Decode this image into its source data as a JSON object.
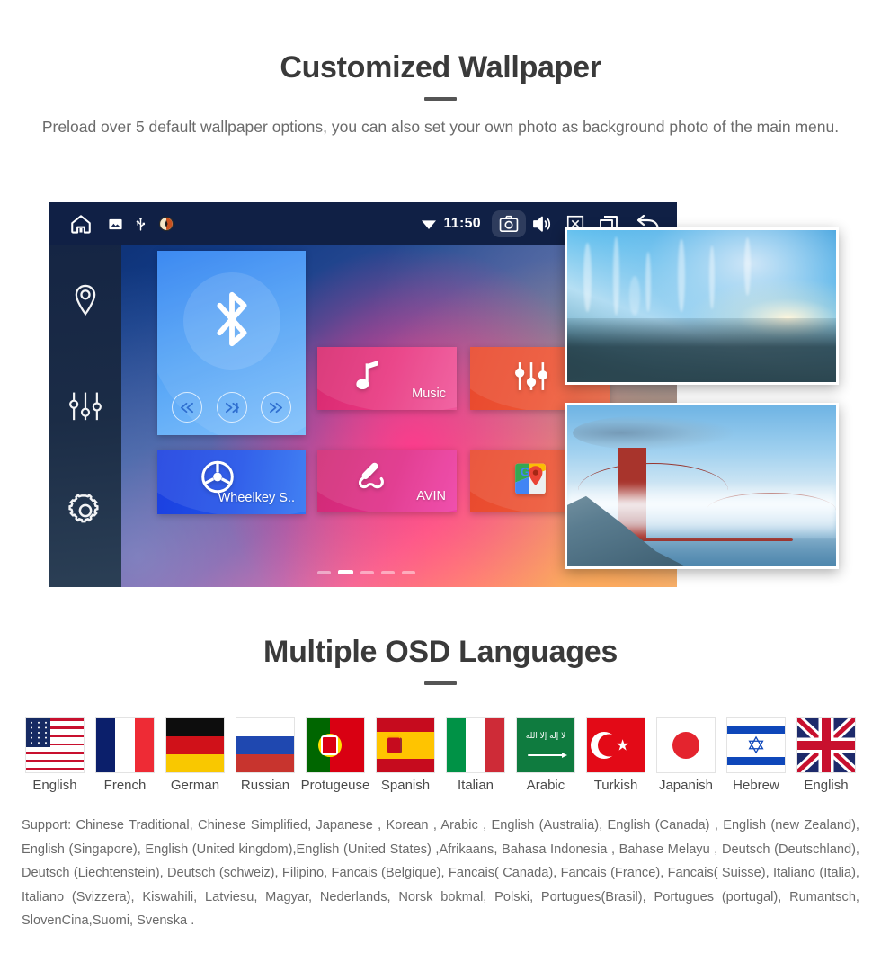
{
  "wallpaper_section": {
    "title": "Customized Wallpaper",
    "subtitle": "Preload over 5 default wallpaper options, you can also set your own photo as background photo of the main menu."
  },
  "head_unit": {
    "statusbar": {
      "home_icon": "home-icon",
      "gallery_icon": "gallery-icon",
      "usb_icon": "usb-icon",
      "compass_icon": "compass-icon",
      "wifi_icon": "wifi-icon",
      "time": "11:50",
      "camera_icon": "camera-icon",
      "volume_icon": "speaker-icon",
      "mute_icon": "close-box-icon",
      "recents_icon": "recents-icon",
      "back_icon": "back-arrow-icon"
    },
    "sidebar": [
      {
        "icon": "location-pin-icon",
        "name": "navigation"
      },
      {
        "icon": "equalizer-icon",
        "name": "equalizer"
      },
      {
        "icon": "gear-icon",
        "name": "settings"
      }
    ],
    "tiles": [
      {
        "label": "",
        "icon": "bluetooth-icon",
        "name": "bluetooth"
      },
      {
        "label": "Wheelkey S..",
        "icon": "steering-wheel-icon",
        "name": "wheelkey-study"
      },
      {
        "label": "Music",
        "icon": "music-note-icon",
        "name": "music"
      },
      {
        "label": "AVIN",
        "icon": "aux-cable-icon",
        "name": "avin"
      },
      {
        "label": "",
        "icon": "equalizer-icon",
        "name": "equalizer-app"
      },
      {
        "label": "",
        "icon": "google-maps-icon",
        "name": "google-maps"
      }
    ],
    "media_controls": {
      "previous": "skip-previous-icon",
      "play": "play-pause-icon",
      "next": "skip-next-icon"
    },
    "pager": {
      "total": 5,
      "active_index": 1
    },
    "wallpaper_thumbnails": [
      {
        "name": "ice-cave-wallpaper"
      },
      {
        "name": "golden-gate-bridge-wallpaper"
      }
    ]
  },
  "languages_section": {
    "title": "Multiple OSD Languages",
    "flags": [
      {
        "name": "English",
        "country": "united-states"
      },
      {
        "name": "French",
        "country": "france"
      },
      {
        "name": "German",
        "country": "germany"
      },
      {
        "name": "Russian",
        "country": "russia"
      },
      {
        "name": "Protugeuse",
        "country": "portugal"
      },
      {
        "name": "Spanish",
        "country": "spain"
      },
      {
        "name": "Italian",
        "country": "italy"
      },
      {
        "name": "Arabic",
        "country": "saudi-arabia"
      },
      {
        "name": "Turkish",
        "country": "turkey"
      },
      {
        "name": "Japanish",
        "country": "japan"
      },
      {
        "name": "Hebrew",
        "country": "israel"
      },
      {
        "name": "English",
        "country": "united-kingdom"
      }
    ],
    "support_text": "Support: Chinese Traditional, Chinese Simplified, Japanese , Korean , Arabic , English (Australia), English (Canada) , English (new Zealand), English (Singapore), English (United kingdom),English (United States) ,Afrikaans, Bahasa Indonesia , Bahase Melayu , Deutsch (Deutschland), Deutsch (Liechtenstein), Deutsch (schweiz), Filipino, Fancais (Belgique), Fancais( Canada), Fancais (France), Fancais( Suisse), Italiano (Italia), Italiano (Svizzera), Kiswahili, Latviesu, Magyar, Nederlands, Norsk bokmal, Polski, Portugues(Brasil), Portugues (portugal), Rumantsch, SlovenCina,Suomi, Svenska ."
  },
  "colors": {
    "heading": "#3a3a3a",
    "body_text": "#6b6b6b",
    "statusbar_bg": "#102045",
    "music_tile": "#e8357f",
    "avin_tile": "#e02d88",
    "maps_tile": "#ed5434",
    "bluetooth_tile": "#4fa0f5",
    "wheelkey_tile": "#1f52e8"
  }
}
